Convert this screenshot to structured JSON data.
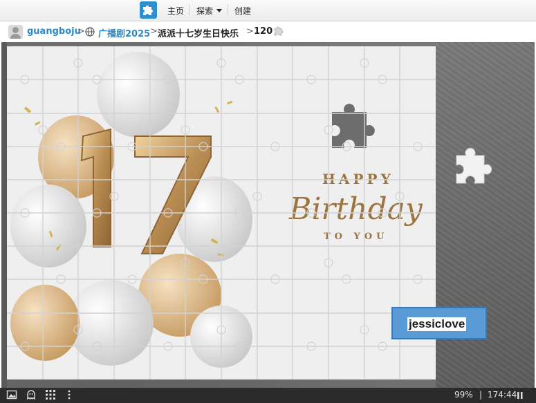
{
  "nav": {
    "home": "主页",
    "explore": "探索",
    "create": "创建"
  },
  "breadcrumb": {
    "user": "guangboju",
    "category": "广播剧2025",
    "puzzle_title": "派派十七岁生日快乐",
    "piece_count": "120",
    "separator": ">"
  },
  "puzzle_image_text": {
    "happy": "HAPPY",
    "birthday": "Birthday",
    "to_you": "TO YOU",
    "number": "17"
  },
  "username_overlay": "jessiclove",
  "statusbar": {
    "progress": "99%",
    "divider": "|",
    "timer": "174:44"
  },
  "colors": {
    "accent": "#2a8bc8",
    "gold": "#b98d52",
    "overlay_blue": "#5b9bd5"
  },
  "icons": [
    "puzzle-logo-icon",
    "globe-icon",
    "puzzle-piece-icon",
    "image-icon",
    "ghost-icon",
    "grid-icon",
    "more-icon",
    "pause-icon"
  ]
}
